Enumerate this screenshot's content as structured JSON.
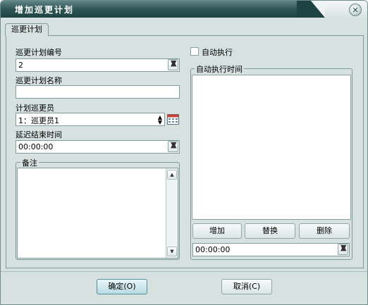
{
  "window": {
    "title": "增加巡更计划",
    "close_icon": "close-icon"
  },
  "tabs": [
    {
      "label": "巡更计划"
    }
  ],
  "form": {
    "plan_number": {
      "label": "巡更计划编号",
      "value": "2"
    },
    "plan_name": {
      "label": "巡更计划名称",
      "value": ""
    },
    "patroller": {
      "label": "计划巡更员",
      "value": "1：巡更员1"
    },
    "delay_end_time": {
      "label": "延迟结束时间",
      "value": "00:00:00"
    },
    "remarks": {
      "label": "备注",
      "value": ""
    }
  },
  "auto": {
    "checkbox_label": "自动执行",
    "checked": false,
    "group_label": "自动执行时间",
    "buttons": {
      "add": "增加",
      "replace": "替换",
      "delete": "删除"
    },
    "time_value": "00:00:00"
  },
  "footer": {
    "ok": "确定(O)",
    "cancel": "取消(C)"
  },
  "colors": {
    "window_bg": "#d6e1e0",
    "titlebar": "#2f5555",
    "accent": "#4f8f99"
  }
}
